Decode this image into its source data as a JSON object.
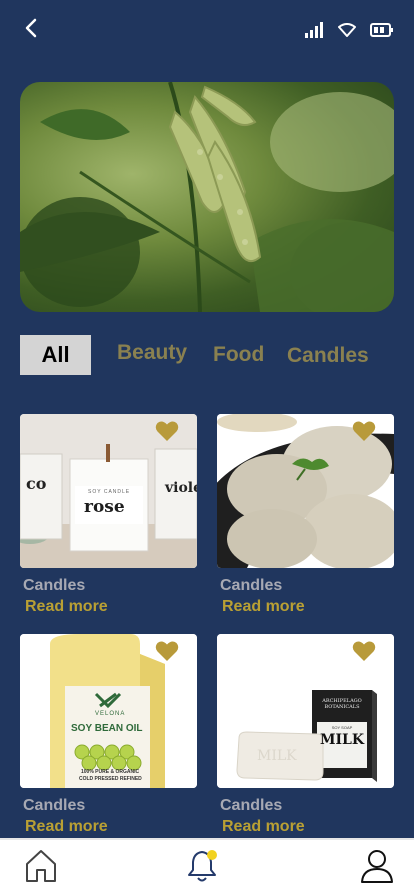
{
  "header": {
    "back_icon": "chevron-left-icon",
    "status_icons": [
      "signal-icon",
      "wifi-icon",
      "battery-icon"
    ]
  },
  "hero": {
    "subject": "soybean-pods-photo"
  },
  "tabs": [
    {
      "label": "All",
      "active": true
    },
    {
      "label": "Beauty",
      "active": false
    },
    {
      "label": "Food",
      "active": false
    },
    {
      "label": "Candles",
      "active": false
    }
  ],
  "products": [
    {
      "category": "Candles",
      "action": "Read more",
      "image": "candles-photo",
      "jar_labels": [
        "co",
        "rose",
        "violet"
      ],
      "jar_small": "SOY CANDLE"
    },
    {
      "category": "Candles",
      "action": "Read more",
      "image": "idli-photo"
    },
    {
      "category": "Candles",
      "action": "Read more",
      "image": "soybean-oil-photo",
      "brand": "VELONA",
      "product": "SOY BEAN OIL",
      "desc1": "100% PURE & ORGANIC",
      "desc2": "COLD PRESSED REFINED"
    },
    {
      "category": "Candles",
      "action": "Read more",
      "image": "milk-soap-photo",
      "box_brand": "ARCHIPELAGO BOTANICALS",
      "box_sub": "SOY SOAP",
      "box_title": "MILK",
      "bar_text": "MILK"
    }
  ],
  "bottom_nav": [
    "home-icon",
    "notification-bell-icon",
    "profile-icon"
  ],
  "colors": {
    "background": "#20365e",
    "accent": "#b9a034",
    "tab_inactive": "#8a8150",
    "heart": "#b89a3a",
    "notification_dot": "#f2d21f"
  }
}
